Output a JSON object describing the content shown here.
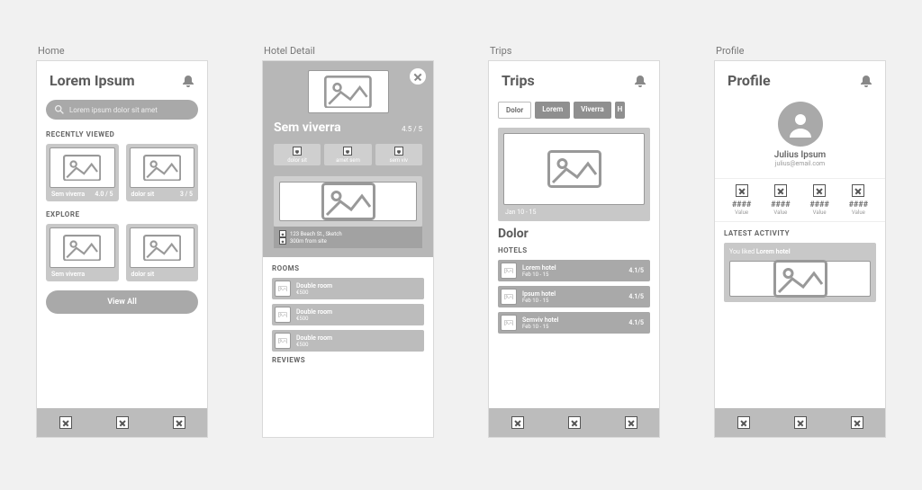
{
  "screens": {
    "home": {
      "label": "Home",
      "title": "Lorem Ipsum",
      "search_placeholder": "Lorem ipsum dolor sit amet",
      "recently_viewed_label": "RECENTLY VIEWED",
      "explore_label": "EXPLORE",
      "recently": [
        {
          "name": "Sem viverra",
          "rating": "4.0 / 5"
        },
        {
          "name": "dolor sit",
          "rating": "3 / 5"
        }
      ],
      "explore": [
        {
          "name": "Sem viverra",
          "rating": ""
        },
        {
          "name": "dolor sit",
          "rating": ""
        }
      ],
      "view_all_label": "View All"
    },
    "detail": {
      "label": "Hotel Detail",
      "name": "Sem viverra",
      "rating": "4.5 / 5",
      "tags": [
        "dolor sit",
        "amet sem",
        "sem viv"
      ],
      "address": "123 Beach St., Sketch",
      "distance": "300m from site",
      "rooms_label": "ROOMS",
      "reviews_label": "REVIEWS",
      "rooms": [
        {
          "name": "Double room",
          "price": "€500"
        },
        {
          "name": "Double room",
          "price": "€500"
        },
        {
          "name": "Double room",
          "price": "€500"
        }
      ]
    },
    "trips": {
      "label": "Trips",
      "title": "Trips",
      "tabs": [
        "Dolor",
        "Lorem",
        "Viverra",
        "H"
      ],
      "active_tab_index": 0,
      "trip": {
        "dates": "Jan 10 - 15",
        "name": "Dolor"
      },
      "hotels_label": "HOTELS",
      "hotels": [
        {
          "name": "Lorem hotel",
          "dates": "Feb 10 - 15",
          "rating": "4.1/5"
        },
        {
          "name": "Ipsum hotel",
          "dates": "Feb 10 - 15",
          "rating": "4.1/5"
        },
        {
          "name": "Semviv hotel",
          "dates": "Feb 10 - 15",
          "rating": "4.1/5"
        }
      ]
    },
    "profile": {
      "label": "Profile",
      "title": "Profile",
      "user_name": "Julius Ipsum",
      "user_email": "julius@email.com",
      "stats": [
        {
          "value": "####",
          "label": "Value"
        },
        {
          "value": "####",
          "label": "Value"
        },
        {
          "value": "####",
          "label": "Value"
        },
        {
          "value": "####",
          "label": "Value"
        }
      ],
      "latest_activity_label": "LATEST ACTIVITY",
      "activity_prefix": "You liked ",
      "activity_target": "Lorem hotel"
    }
  }
}
